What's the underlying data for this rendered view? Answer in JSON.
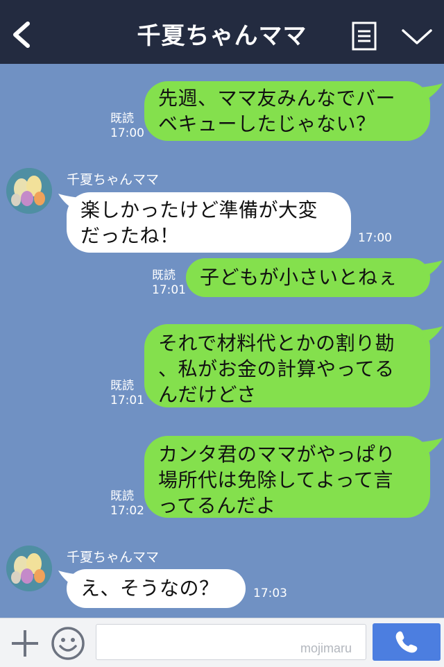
{
  "header": {
    "title": "千夏ちゃんママ",
    "back_icon": "chevron-left-icon",
    "menu_icon": "notes-icon",
    "collapse_icon": "chevron-down-icon"
  },
  "colors": {
    "header_bg": "#232b40",
    "chat_bg": "#7091c3",
    "outgoing_bubble": "#84e04d",
    "incoming_bubble": "#ffffff",
    "send_button": "#4c7ee0"
  },
  "messages": [
    {
      "direction": "out",
      "text": "先週、ママ友みんなでバー\nベキューしたじゃない？",
      "read": "既読",
      "time": "17:00"
    },
    {
      "direction": "in",
      "sender": "千夏ちゃんママ",
      "text": "楽しかったけど準備が大変\nだったね！",
      "time": "17:00"
    },
    {
      "direction": "out",
      "text": "子どもが小さいとねぇ",
      "read": "既読",
      "time": "17:01"
    },
    {
      "direction": "out",
      "text": "それで材料代とかの割り勘\n、私がお金の計算やってる\nんだけどさ",
      "read": "既読",
      "time": "17:01"
    },
    {
      "direction": "out",
      "text": "カンタ君のママがやっぱり\n場所代は免除してよって言\nってるんだよ",
      "read": "既読",
      "time": "17:02"
    },
    {
      "direction": "in",
      "sender": "千夏ちゃんママ",
      "text": "え、そうなの？",
      "time": "17:03"
    }
  ],
  "footer": {
    "input_value": "",
    "watermark": "mojimaru",
    "plus_icon": "plus-icon",
    "sticker_icon": "smiley-icon",
    "call_icon": "phone-icon"
  }
}
